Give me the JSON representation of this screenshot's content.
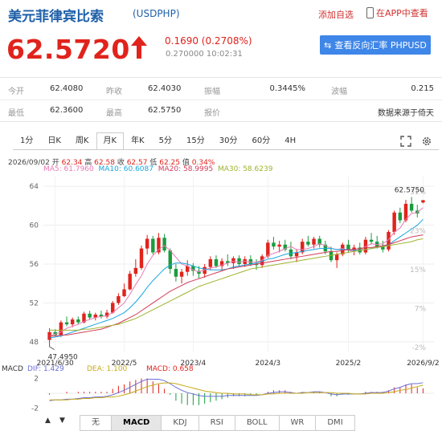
{
  "header": {
    "title": "美元菲律宾比索",
    "code": "(USDPHP)",
    "add_watch": "添加自选",
    "open_app": "在APP中查看"
  },
  "quote": {
    "price": "62.5720",
    "change": "0.1690 (0.2708%)",
    "time": "0.270000 10:02:31",
    "swap_button": "查看反向汇率 PHPUSD",
    "up_color": "#e0231c"
  },
  "stats": {
    "row1": [
      {
        "label": "今开",
        "value": "62.4080"
      },
      {
        "label": "昨收",
        "value": "62.4030"
      },
      {
        "label": "振幅",
        "value": "0.3445%"
      },
      {
        "label": "波幅",
        "value": "0.215"
      }
    ],
    "row2": [
      {
        "label": "最低",
        "value": "62.3600"
      },
      {
        "label": "最高",
        "value": "62.5750"
      },
      {
        "label": "报价",
        "value": "数据来源于倚天"
      }
    ]
  },
  "period_tabs": [
    "1分",
    "日K",
    "周K",
    "月K",
    "年K",
    "5分",
    "15分",
    "30分",
    "60分",
    "4H"
  ],
  "active_tab": "月K",
  "ohlc_line": {
    "date": "2026/09/02",
    "open_label": "开",
    "open": "62.34",
    "high_label": "高",
    "high": "62.58",
    "close_label": "收",
    "close": "62.57",
    "low_label": "低",
    "low": "62.25",
    "change_label": "值",
    "change": "0.34%"
  },
  "ma_legend": [
    {
      "label": "MA5: 61.7960",
      "color": "#e67bb3"
    },
    {
      "label": "MA10: 60.6087",
      "color": "#19a6e0"
    },
    {
      "label": "MA20: 58.9995",
      "color": "#d23c5a"
    },
    {
      "label": "MA30: 58.6239",
      "color": "#9fb32c"
    }
  ],
  "chart_data": {
    "type": "candlestick",
    "ylim": [
      47,
      65
    ],
    "y_ticks": [
      "64",
      "60",
      "56",
      "52",
      "48"
    ],
    "pct_ticks": [
      "31%",
      "23%",
      "15%",
      "7%",
      "-2%"
    ],
    "x_ticks": [
      "2021/6/30",
      "2022/5",
      "2023/4",
      "2024/3",
      "2025/2",
      "2026/9/2"
    ],
    "max_label": "62.5750",
    "min_label": "47.4950",
    "candles": [
      [
        48.2,
        49.4,
        47.5,
        49.0
      ],
      [
        49.0,
        49.3,
        48.6,
        48.7
      ],
      [
        48.7,
        50.2,
        48.5,
        50.0
      ],
      [
        50.0,
        50.6,
        49.6,
        49.8
      ],
      [
        49.8,
        50.5,
        49.5,
        50.3
      ],
      [
        50.3,
        50.6,
        49.8,
        50.0
      ],
      [
        50.0,
        51.1,
        49.9,
        50.9
      ],
      [
        50.9,
        51.2,
        50.3,
        50.5
      ],
      [
        50.5,
        51.0,
        50.2,
        50.8
      ],
      [
        50.8,
        51.2,
        50.4,
        50.6
      ],
      [
        50.6,
        51.3,
        50.4,
        51.0
      ],
      [
        51.0,
        52.2,
        50.9,
        52.0
      ],
      [
        52.0,
        53.0,
        51.8,
        52.7
      ],
      [
        52.7,
        54.0,
        52.6,
        53.4
      ],
      [
        53.4,
        55.3,
        53.3,
        55.0
      ],
      [
        55.0,
        56.5,
        54.7,
        55.6
      ],
      [
        55.6,
        57.9,
        55.4,
        57.6
      ],
      [
        57.6,
        59.0,
        57.0,
        58.6
      ],
      [
        58.6,
        58.9,
        57.0,
        57.2
      ],
      [
        57.2,
        59.2,
        57.0,
        58.7
      ],
      [
        58.7,
        59.1,
        57.2,
        57.4
      ],
      [
        57.4,
        57.6,
        55.0,
        55.5
      ],
      [
        55.5,
        56.0,
        54.2,
        54.7
      ],
      [
        54.7,
        55.5,
        54.0,
        55.2
      ],
      [
        55.2,
        56.4,
        54.8,
        55.8
      ],
      [
        55.8,
        56.1,
        54.8,
        55.3
      ],
      [
        55.3,
        55.8,
        54.5,
        55.0
      ],
      [
        55.0,
        56.0,
        54.6,
        55.7
      ],
      [
        55.7,
        56.8,
        55.4,
        56.5
      ],
      [
        56.5,
        56.9,
        55.6,
        55.8
      ],
      [
        55.8,
        56.6,
        55.3,
        56.3
      ],
      [
        56.3,
        57.0,
        55.8,
        56.1
      ],
      [
        56.1,
        56.8,
        55.5,
        56.6
      ],
      [
        56.6,
        56.9,
        55.8,
        56.0
      ],
      [
        56.0,
        56.8,
        55.7,
        56.5
      ],
      [
        56.5,
        56.9,
        55.8,
        56.0
      ],
      [
        56.0,
        56.5,
        55.4,
        55.9
      ],
      [
        55.9,
        57.0,
        55.6,
        56.8
      ],
      [
        56.8,
        58.5,
        56.6,
        58.2
      ],
      [
        58.2,
        58.8,
        57.5,
        57.8
      ],
      [
        57.8,
        58.4,
        57.2,
        58.0
      ],
      [
        58.0,
        58.5,
        57.3,
        57.5
      ],
      [
        57.5,
        58.3,
        56.5,
        56.8
      ],
      [
        56.8,
        57.5,
        56.2,
        57.2
      ],
      [
        57.2,
        58.6,
        57.0,
        58.3
      ],
      [
        58.3,
        58.9,
        57.8,
        58.0
      ],
      [
        58.0,
        58.8,
        57.6,
        58.6
      ],
      [
        58.6,
        58.9,
        57.7,
        58.0
      ],
      [
        58.0,
        58.4,
        57.0,
        57.3
      ],
      [
        57.3,
        57.8,
        56.2,
        56.4
      ],
      [
        56.4,
        57.2,
        55.6,
        57.0
      ],
      [
        57.0,
        58.2,
        56.8,
        58.0
      ],
      [
        58.0,
        58.5,
        57.2,
        57.4
      ],
      [
        57.4,
        58.0,
        56.9,
        57.7
      ],
      [
        57.7,
        58.2,
        57.0,
        57.2
      ],
      [
        57.2,
        58.8,
        57.0,
        58.5
      ],
      [
        58.5,
        59.2,
        58.0,
        58.3
      ],
      [
        58.3,
        58.9,
        57.6,
        57.8
      ],
      [
        57.8,
        58.4,
        57.2,
        57.5
      ],
      [
        57.5,
        59.5,
        57.3,
        59.3
      ],
      [
        59.3,
        61.5,
        59.0,
        61.3
      ],
      [
        61.3,
        61.8,
        60.2,
        60.5
      ],
      [
        60.5,
        62.6,
        60.3,
        62.2
      ],
      [
        62.2,
        62.9,
        61.3,
        61.5
      ],
      [
        61.5,
        62.1,
        60.8,
        61.2
      ],
      [
        62.34,
        62.58,
        62.25,
        62.57
      ]
    ],
    "ma_series": [
      {
        "name": "MA5",
        "color": "#e67bb3",
        "values": [
          48.6,
          48.8,
          49.0,
          49.4,
          49.6,
          49.8,
          50.1,
          50.3,
          50.5,
          50.6,
          50.7,
          51.0,
          51.5,
          52.0,
          52.9,
          53.9,
          54.8,
          56.0,
          56.9,
          57.5,
          57.9,
          57.4,
          56.7,
          56.0,
          55.8,
          55.4,
          55.2,
          55.4,
          55.6,
          55.7,
          55.9,
          56.1,
          56.3,
          56.2,
          56.3,
          56.2,
          56.2,
          56.4,
          56.9,
          57.1,
          57.3,
          57.6,
          57.8,
          57.5,
          57.5,
          57.6,
          57.8,
          58.1,
          57.9,
          57.6,
          57.5,
          57.6,
          57.4,
          57.3,
          57.4,
          57.8,
          58.1,
          58.0,
          58.1,
          58.5,
          59.3,
          59.7,
          60.6,
          61.2,
          61.3,
          61.8
        ]
      },
      {
        "name": "MA10",
        "color": "#19a6e0",
        "values": [
          48.4,
          48.5,
          48.6,
          48.8,
          49.0,
          49.2,
          49.4,
          49.6,
          49.8,
          50.0,
          50.2,
          50.4,
          50.7,
          51.0,
          51.5,
          52.1,
          52.8,
          53.6,
          54.3,
          54.9,
          55.5,
          55.9,
          56.1,
          56.1,
          56.0,
          55.8,
          55.6,
          55.5,
          55.4,
          55.4,
          55.4,
          55.5,
          55.7,
          55.8,
          55.9,
          56.0,
          56.1,
          56.3,
          56.5,
          56.6,
          56.8,
          57.0,
          57.1,
          57.2,
          57.3,
          57.4,
          57.5,
          57.6,
          57.6,
          57.6,
          57.5,
          57.5,
          57.5,
          57.4,
          57.4,
          57.5,
          57.6,
          57.7,
          57.8,
          58.0,
          58.4,
          58.8,
          59.2,
          59.6,
          60.0,
          60.6
        ]
      },
      {
        "name": "MA20",
        "color": "#d23c5a",
        "values": [
          48.6,
          48.6,
          48.7,
          48.7,
          48.8,
          48.9,
          49.0,
          49.1,
          49.2,
          49.3,
          49.5,
          49.7,
          49.9,
          50.2,
          50.5,
          50.8,
          51.2,
          51.6,
          52.0,
          52.4,
          52.8,
          53.2,
          53.5,
          53.8,
          54.1,
          54.3,
          54.5,
          54.7,
          54.9,
          55.1,
          55.3,
          55.5,
          55.6,
          55.7,
          55.8,
          55.9,
          56.0,
          56.1,
          56.2,
          56.3,
          56.4,
          56.5,
          56.6,
          56.7,
          56.8,
          56.9,
          57.0,
          57.1,
          57.2,
          57.3,
          57.3,
          57.4,
          57.5,
          57.5,
          57.6,
          57.7,
          57.7,
          57.8,
          57.9,
          58.0,
          58.2,
          58.4,
          58.6,
          58.8,
          58.9,
          59.0
        ]
      },
      {
        "name": "MA30",
        "color": "#9fb32c",
        "values": [
          49.2,
          49.2,
          49.2,
          49.2,
          49.2,
          49.2,
          49.3,
          49.3,
          49.4,
          49.5,
          49.6,
          49.7,
          49.8,
          50.0,
          50.2,
          50.4,
          50.7,
          51.0,
          51.3,
          51.6,
          51.9,
          52.2,
          52.5,
          52.8,
          53.1,
          53.4,
          53.7,
          53.9,
          54.1,
          54.3,
          54.5,
          54.7,
          54.9,
          55.1,
          55.3,
          55.5,
          55.6,
          55.7,
          55.8,
          55.9,
          56.0,
          56.1,
          56.2,
          56.3,
          56.4,
          56.5,
          56.6,
          56.7,
          56.8,
          56.9,
          57.0,
          57.1,
          57.2,
          57.3,
          57.4,
          57.5,
          57.6,
          57.7,
          57.8,
          57.9,
          58.0,
          58.1,
          58.2,
          58.3,
          58.5,
          58.6
        ]
      }
    ],
    "macd": {
      "title": "MACD",
      "dif_label": "DIF: 1.429",
      "dea_label": "DEA: 1.100",
      "macd_label": "MACD: 0.658",
      "y_ticks": [
        "2",
        "-2"
      ],
      "ylim": [
        -2.6,
        2.6
      ],
      "dif": [
        -1.0,
        -0.9,
        -0.9,
        -0.8,
        -0.8,
        -0.7,
        -0.6,
        -0.6,
        -0.5,
        -0.5,
        -0.4,
        -0.2,
        0.1,
        0.4,
        0.8,
        1.2,
        1.6,
        1.9,
        1.9,
        1.9,
        1.7,
        1.3,
        0.8,
        0.4,
        0.1,
        -0.1,
        -0.3,
        -0.4,
        -0.4,
        -0.4,
        -0.4,
        -0.3,
        -0.3,
        -0.3,
        -0.3,
        -0.3,
        -0.3,
        -0.2,
        0.0,
        0.1,
        0.2,
        0.2,
        0.1,
        0.0,
        0.1,
        0.1,
        0.2,
        0.2,
        0.1,
        -0.1,
        -0.2,
        -0.1,
        -0.1,
        -0.1,
        -0.1,
        0.0,
        0.1,
        0.1,
        0.1,
        0.3,
        0.6,
        0.8,
        1.1,
        1.3,
        1.3,
        1.429
      ],
      "dea": [
        -0.9,
        -0.9,
        -0.9,
        -0.9,
        -0.8,
        -0.8,
        -0.7,
        -0.7,
        -0.6,
        -0.6,
        -0.5,
        -0.5,
        -0.4,
        -0.2,
        0.0,
        0.3,
        0.6,
        0.9,
        1.1,
        1.3,
        1.4,
        1.4,
        1.3,
        1.1,
        0.9,
        0.7,
        0.5,
        0.3,
        0.2,
        0.1,
        0.0,
        0.0,
        -0.1,
        -0.1,
        -0.1,
        -0.2,
        -0.2,
        -0.2,
        -0.1,
        -0.1,
        0.0,
        0.0,
        0.0,
        0.0,
        0.0,
        0.1,
        0.1,
        0.1,
        0.1,
        0.1,
        0.0,
        0.0,
        0.0,
        -0.1,
        -0.1,
        -0.1,
        0.0,
        0.0,
        0.0,
        0.1,
        0.2,
        0.4,
        0.5,
        0.7,
        0.9,
        1.1
      ]
    }
  },
  "bottom_tabs": [
    "无",
    "MACD",
    "KDJ",
    "RSI",
    "BOLL",
    "WR",
    "DMI"
  ],
  "bottom_active": "MACD",
  "nav_up": "▲",
  "nav_down": "▼",
  "icons": {
    "phone": "phone-icon",
    "swap": "swap-icon",
    "fullscreen": "fullscreen-icon",
    "settings": "settings-icon",
    "arrow": "up-arrow-icon"
  }
}
